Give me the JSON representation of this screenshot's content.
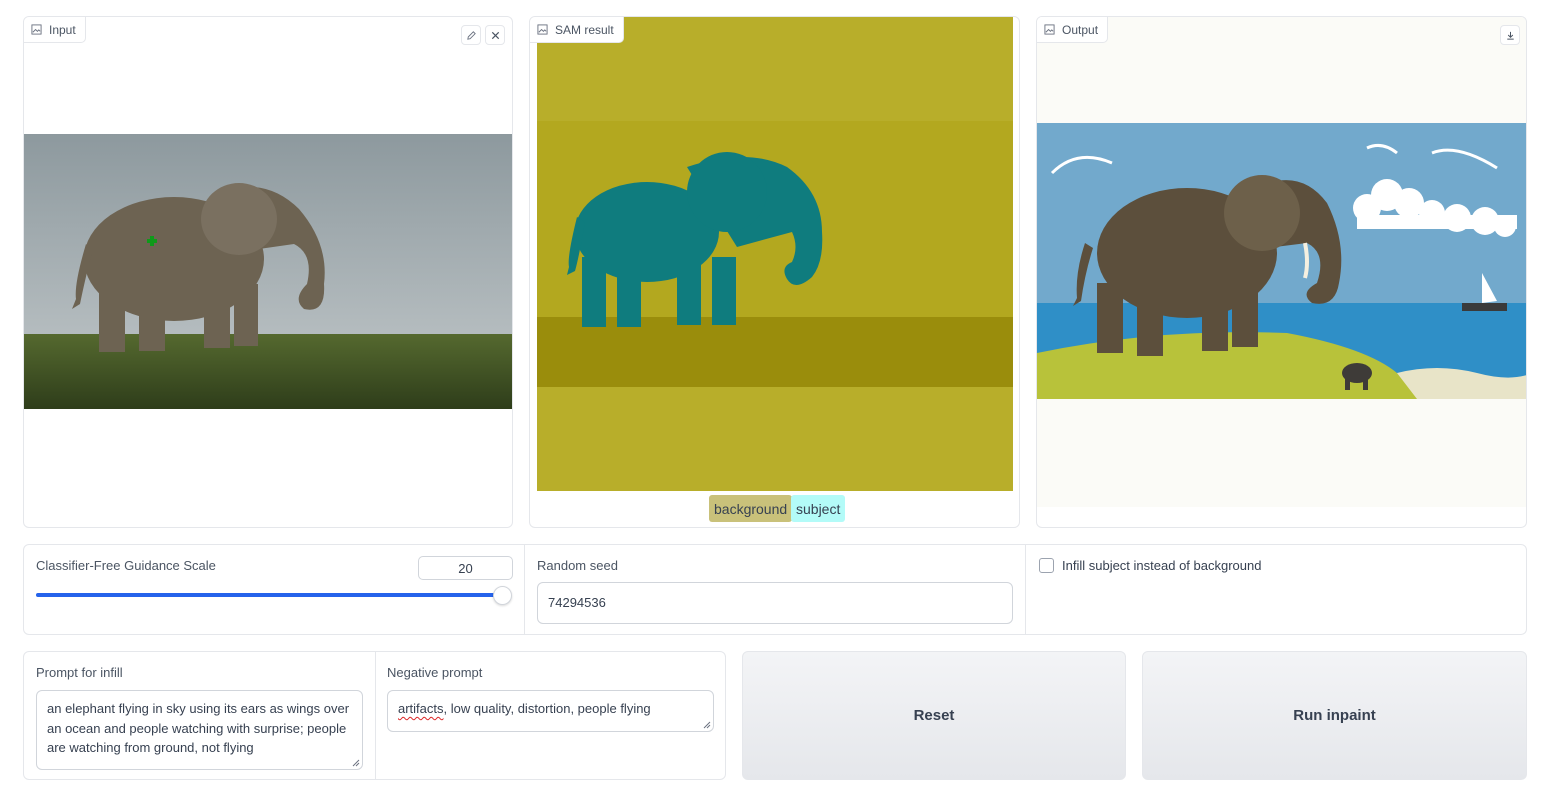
{
  "input_panel": {
    "label": "Input",
    "icon": "image-icon",
    "edit_icon": "pencil-icon",
    "close_icon": "close-icon"
  },
  "sam_panel": {
    "label": "SAM result",
    "icon": "image-icon",
    "legend": [
      {
        "label": "background",
        "color": "#c9c17a"
      },
      {
        "label": "subject",
        "color": "#b3fbf8"
      }
    ]
  },
  "output_panel": {
    "label": "Output",
    "icon": "image-icon",
    "download_icon": "download-icon"
  },
  "guidance": {
    "label": "Classifier-Free Guidance Scale",
    "value": "20",
    "slider_fraction": 1.0
  },
  "seed": {
    "label": "Random seed",
    "value": "74294536"
  },
  "infill_checkbox": {
    "label": "Infill subject instead of background",
    "checked": false
  },
  "prompt": {
    "label": "Prompt for infill",
    "value": "an elephant flying in sky using its ears as wings over an ocean and people watching with surprise; people are watching from ground, not flying"
  },
  "negative_prompt": {
    "label": "Negative prompt",
    "misspelled": "artifacts",
    "rest": ", low quality, distortion, people flying"
  },
  "buttons": {
    "reset": "Reset",
    "run": "Run inpaint"
  },
  "colors": {
    "accent": "#2563eb",
    "sam_background": "#b8ae2a",
    "sam_subject": "#0f7c7e",
    "sky": "#72a9cc"
  }
}
